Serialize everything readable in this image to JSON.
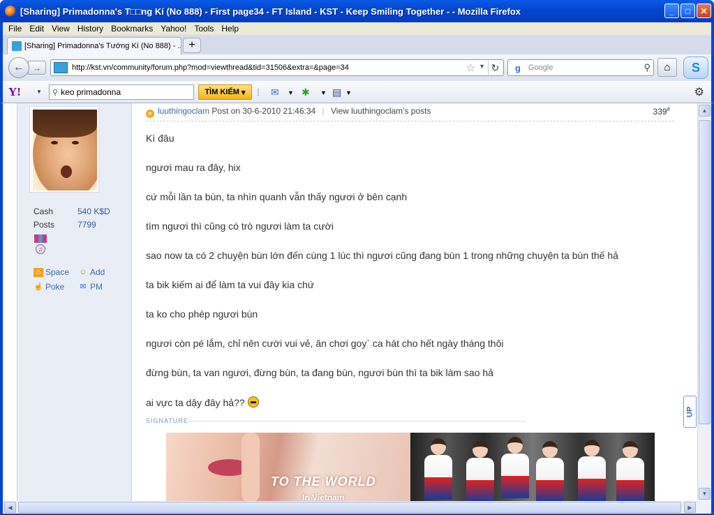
{
  "window": {
    "title": "[Sharing] Primadonna's T□□ng Kí (No 888) - First page34 - FT Island - KST - Keep Smiling Together - - Mozilla Firefox",
    "minimize": "_",
    "maximize": "□",
    "close": "✕"
  },
  "menu": [
    "File",
    "Edit",
    "View",
    "History",
    "Bookmarks",
    "Yahoo!",
    "Tools",
    "Help"
  ],
  "tab": {
    "label": "[Sharing] Primadonna's Tướng Kí (No 888) - ...",
    "new_tab": "+"
  },
  "nav": {
    "back": "←",
    "forward": "→",
    "url": "http://kst.vn/community/forum.php?mod=viewthread&tid=31506&extra=&page=34",
    "star": "☆",
    "reload": "↻",
    "search_placeholder": "Google",
    "home": "⌂"
  },
  "yahoo_toolbar": {
    "logo": "Y!",
    "search_value": "keo primadonna",
    "search_button": "TÌM KIẾM",
    "settings_icon": "gear-icon"
  },
  "user": {
    "stats": [
      {
        "key": "Cash",
        "value": "540 K$D"
      },
      {
        "key": "Posts",
        "value": "7799"
      }
    ],
    "links": [
      {
        "label": "Space",
        "icon": "home-icon"
      },
      {
        "label": "Add",
        "icon": "add-friend-icon"
      },
      {
        "label": "Poke",
        "icon": "poke-icon"
      },
      {
        "label": "PM",
        "icon": "mail-icon"
      }
    ]
  },
  "post": {
    "author": "luuthingoclam",
    "posted": "Post on 30-6-2010 21:46:34",
    "view_link": "View luuthingoclam's posts",
    "number": "339",
    "number_suffix": "#",
    "lines": [
      "Kì đâu",
      "ngươi mau ra đây, hix",
      "cứ mỗi lần ta bùn, ta nhìn quanh vẫn thấy ngươi ở bên cạnh",
      "tìm ngươi thì cũng có trò ngươi làm ta cười",
      "sao now ta có 2 chuyện bùn lớn đến cùng 1 lúc thì ngươi cũng đang bùn 1 trong những chuyện ta bùn thế hả",
      "ta bik kiếm ai để làm ta vui đây kia chứ",
      "ta ko cho phép ngươi bùn",
      "ngươi còn pé lắm, chỉ nên cười vui vẻ, ăn chơi goy` ca hát cho hết ngày tháng thôi",
      "đừng bùn, ta van ngươi, đừng bùn, ta đang bùn, ngươi bùn thì ta bik làm sao hả",
      "ai vực ta dậy đây hả??"
    ],
    "signature_label": "SIGNATURE",
    "banner_text": "TO THE WORLD",
    "banner_subtext": "In Vietnam"
  },
  "scroll": {
    "up_label": "UP"
  }
}
